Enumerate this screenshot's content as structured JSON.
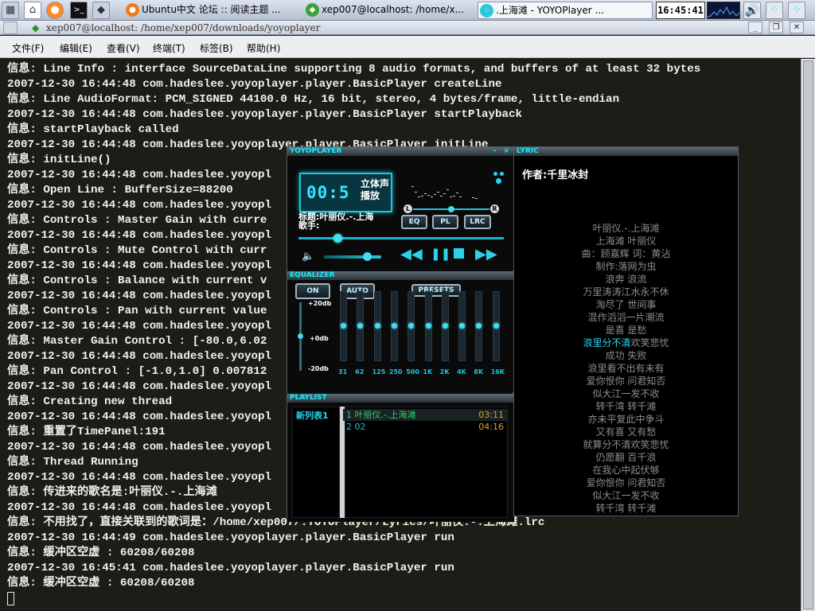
{
  "taskbar": {
    "tasks": [
      {
        "label": "Ubuntu中文 论坛 :: 阅读主题 ..."
      },
      {
        "label": "xep007@localhost: /home/x..."
      },
      {
        "label": ".上海滩 - YOYOPlayer   ..."
      }
    ],
    "clock": "16:45:41"
  },
  "terminal": {
    "title": "xep007@localhost: /home/xep007/downloads/yoyoplayer",
    "menu": [
      "文件(F)",
      "编辑(E)",
      "查看(V)",
      "终端(T)",
      "标签(B)",
      "帮助(H)"
    ],
    "lines": [
      "信息: Line Info : interface SourceDataLine supporting 8 audio formats, and buffers of at least 32 bytes",
      "2007-12-30 16:44:48 com.hadeslee.yoyoplayer.player.BasicPlayer createLine",
      "信息: Line AudioFormat: PCM_SIGNED 44100.0 Hz, 16 bit, stereo, 4 bytes/frame, little-endian",
      "2007-12-30 16:44:48 com.hadeslee.yoyoplayer.player.BasicPlayer startPlayback",
      "信息: startPlayback called",
      "2007-12-30 16:44:48 com.hadeslee.yoyoplayer.player.BasicPlayer initLine",
      "信息: initLine()",
      "2007-12-30 16:44:48 com.hadeslee.yoyopl",
      "信息: Open Line : BufferSize=88200",
      "2007-12-30 16:44:48 com.hadeslee.yoyopl",
      "信息: Controls : Master Gain with curre",
      "2007-12-30 16:44:48 com.hadeslee.yoyopl",
      "信息: Controls : Mute Control with curr",
      "2007-12-30 16:44:48 com.hadeslee.yoyopl",
      "信息: Controls : Balance with current v",
      "2007-12-30 16:44:48 com.hadeslee.yoyopl",
      "信息: Controls : Pan with current value",
      "2007-12-30 16:44:48 com.hadeslee.yoyopl",
      "信息: Master Gain Control : [-80.0,6.02",
      "2007-12-30 16:44:48 com.hadeslee.yoyopl",
      "信息: Pan Control : [-1.0,1.0] 0.007812",
      "2007-12-30 16:44:48 com.hadeslee.yoyopl",
      "信息: Creating new thread",
      "2007-12-30 16:44:48 com.hadeslee.yoyopl",
      "信息: 重置了TimePanel:191",
      "2007-12-30 16:44:48 com.hadeslee.yoyopl",
      "信息: Thread Running",
      "2007-12-30 16:44:48 com.hadeslee.yoyopl",
      "信息: 传进来的歌名是:叶丽仪.-.上海滩",
      "2007-12-30 16:44:48 com.hadeslee.yoyopl",
      "信息: 不用找了，直接关联到的歌词是：/home/xep007/.YOYOPlayer/Lyrics/叶丽仪.-.上海滩.lrc",
      "2007-12-30 16:44:49 com.hadeslee.yoyoplayer.player.BasicPlayer run",
      "信息: 缓冲区空虚 : 60208/60208",
      "2007-12-30 16:45:41 com.hadeslee.yoyoplayer.player.BasicPlayer run",
      "信息: 缓冲区空虚 : 60208/60208"
    ]
  },
  "player": {
    "title": "YOYOPLAYER",
    "time_display": "00:5",
    "stereo_label": "立体声",
    "play_label": "播放",
    "scroll_text": "标题:叶丽仪.-.上海",
    "scroll_text2": "歌手:",
    "bal_left": "L",
    "bal_right": "R",
    "buttons": {
      "eq": "EQ",
      "pl": "PL",
      "lrc": "LRC"
    },
    "position_fraction": 0.19,
    "volume_fraction": 0.75,
    "equalizer": {
      "title": "EQUALIZER",
      "on_label": "ON",
      "auto_label": "AUTO",
      "presets_label": "PRESETS",
      "db_labels": [
        "+20db",
        "+0db",
        "-20db"
      ],
      "bands": [
        "31",
        "62",
        "125",
        "250",
        "500",
        "1K",
        "2K",
        "4K",
        "8K",
        "16K"
      ],
      "band_levels": [
        0.5,
        0.5,
        0.5,
        0.5,
        0.5,
        0.5,
        0.5,
        0.5,
        0.5,
        0.5
      ]
    },
    "playlist": {
      "title": "PLAYLIST",
      "list_name": "新列表1",
      "items": [
        {
          "num": "1",
          "name": "叶丽仪.-.上海滩",
          "duration": "03:11"
        },
        {
          "num": "2",
          "name": "02",
          "duration": "04:16"
        }
      ]
    }
  },
  "lyric": {
    "title": "LYRIC",
    "author": "作者:千里冰封",
    "lines": [
      "叶丽仪.-.上海滩",
      "上海滩   叶丽仪",
      "曲：顾嘉辉  词：黄沾",
      "制作:落网为虫",
      "浪奔  浪流",
      "万里涛涛江水永不休",
      "淘尽了  世间事",
      "混作滔滔一片潮流",
      "是喜  是愁",
      "浪里分不清欢笑悲忧",
      "成功  失败",
      "浪里看不出有未有",
      "爱你恨你  问君知否",
      "似大江一发不收",
      "转千湾  转千滩",
      "亦未平复此中争斗",
      "又有喜  又有愁",
      "就算分不清欢笑悲忧",
      "仍愿翻  百千浪",
      "在我心中起伏够",
      "爱你恨你  问君知否",
      "似大江一发不收",
      "转千湾  转千滩"
    ],
    "current_index": 9,
    "current_sung": "浪里分不清"
  },
  "colors": {
    "terminal_bg": "#1d1d17",
    "accent": "#28d8f0"
  }
}
